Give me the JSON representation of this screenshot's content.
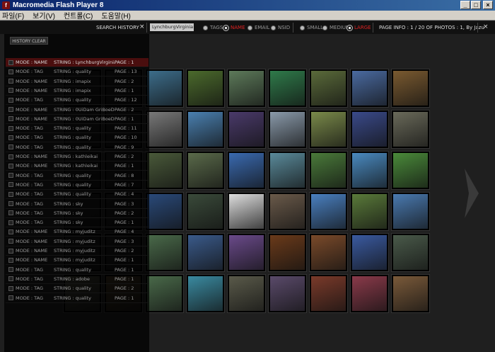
{
  "window": {
    "title": "Macromedia Flash Player 8",
    "icon": "flash-icon",
    "minimize": "_",
    "maximize": "□",
    "close": "×"
  },
  "menu": [
    "파일(F)",
    "보기(V)",
    "컨트롤(C)",
    "도움말(H)"
  ],
  "toolbar": {
    "search_history_label": "SEARCH HISTORY",
    "close_glyph": "×",
    "search_value": "LynchburgVirginia",
    "search_type_options": [
      {
        "label": "TAGS",
        "selected": false
      },
      {
        "label": "NAME",
        "selected": true
      },
      {
        "label": "EMAIL",
        "selected": false
      },
      {
        "label": "NSID",
        "selected": false
      }
    ],
    "size_options": [
      {
        "label": "SMALL",
        "selected": false
      },
      {
        "label": "MEDIUM",
        "selected": false
      },
      {
        "label": "LARGE",
        "selected": true
      }
    ],
    "page_info": "PAGE INFO : 1 / 20 OF PHOTOS : 1, By Jazu",
    "accent_color": "#d22222"
  },
  "history": {
    "clear_label": "HISTORY CLEAR",
    "rows": [
      {
        "mode": "MODE : NAME",
        "string": "STRING : LynchburgVirginia",
        "page": "PAGE : 1",
        "active": true
      },
      {
        "mode": "MODE : TAG",
        "string": "STRING : quality",
        "page": "PAGE : 13"
      },
      {
        "mode": "MODE : NAME",
        "string": "STRING : imapix",
        "page": "PAGE : 2"
      },
      {
        "mode": "MODE : NAME",
        "string": "STRING : imapix",
        "page": "PAGE : 1"
      },
      {
        "mode": "MODE : TAG",
        "string": "STRING : quality",
        "page": "PAGE : 12"
      },
      {
        "mode": "MODE : NAME",
        "string": "STRING : 0UiDam GriBoeDou",
        "page": "PAGE : 2"
      },
      {
        "mode": "MODE : NAME",
        "string": "STRING : 0UiDam GriBoeDou",
        "page": "PAGE : 1"
      },
      {
        "mode": "MODE : TAG",
        "string": "STRING : quality",
        "page": "PAGE : 11"
      },
      {
        "mode": "MODE : TAG",
        "string": "STRING : quality",
        "page": "PAGE : 10"
      },
      {
        "mode": "MODE : TAG",
        "string": "STRING : quality",
        "page": "PAGE : 9"
      },
      {
        "mode": "MODE : NAME",
        "string": "STRING : kathleikai",
        "page": "PAGE : 2"
      },
      {
        "mode": "MODE : NAME",
        "string": "STRING : kathleikai",
        "page": "PAGE : 1"
      },
      {
        "mode": "MODE : TAG",
        "string": "STRING : quality",
        "page": "PAGE : 8"
      },
      {
        "mode": "MODE : TAG",
        "string": "STRING : quality",
        "page": "PAGE : 7"
      },
      {
        "mode": "MODE : TAG",
        "string": "STRING : quality",
        "page": "PAGE : 4"
      },
      {
        "mode": "MODE : TAG",
        "string": "STRING : sky",
        "page": "PAGE : 3"
      },
      {
        "mode": "MODE : TAG",
        "string": "STRING : sky",
        "page": "PAGE : 2"
      },
      {
        "mode": "MODE : TAG",
        "string": "STRING : sky",
        "page": "PAGE : 1"
      },
      {
        "mode": "MODE : NAME",
        "string": "STRING : myjuditz",
        "page": "PAGE : 4"
      },
      {
        "mode": "MODE : NAME",
        "string": "STRING : myjuditz",
        "page": "PAGE : 3"
      },
      {
        "mode": "MODE : NAME",
        "string": "STRING : myjuditz",
        "page": "PAGE : 2"
      },
      {
        "mode": "MODE : NAME",
        "string": "STRING : myjuditz",
        "page": "PAGE : 1"
      },
      {
        "mode": "MODE : TAG",
        "string": "STRING : quality",
        "page": "PAGE : 1"
      },
      {
        "mode": "MODE : TAG",
        "string": "STRING : adobe",
        "page": "PAGE : 1"
      },
      {
        "mode": "MODE : TAG",
        "string": "STRING : quality",
        "page": "PAGE : 2"
      },
      {
        "mode": "MODE : TAG",
        "string": "STRING : quality",
        "page": "PAGE : 1"
      }
    ]
  },
  "photos": {
    "columns": 9,
    "rows": 6,
    "tiles": [
      [
        "#1a1a1a",
        "#1a1a1a",
        "#3d6e8c",
        "#4b6a2c",
        "#5d7a5a",
        "#2f7a4a",
        "#5a6a3a",
        "#4a6aa0",
        "#7a5a30"
      ],
      [
        "#1a1a1a",
        "#1a1a1a",
        "#7a7a7a",
        "#4a80b0",
        "#4a3a6a",
        "#8a9aaa",
        "#7a8a4a",
        "#3a4a8a",
        "#6a6a5a"
      ],
      [
        "#1a1a1a",
        "#1a1a1a",
        "#4a5a3a",
        "#5a6a4a",
        "#3a6ab0",
        "#5a8a9a",
        "#4a7a3a",
        "#4a8ac0",
        "#4a8a3a"
      ],
      [
        "#1a1a1a",
        "#1a1a1a",
        "#2a4a7a",
        "#3a4a3a",
        "#ddd",
        "#6a5a4a",
        "#4a80c0",
        "#5a7a3a",
        "#4a7ab0"
      ],
      [
        "#1a1a1a",
        "#1a1a1a",
        "#4a6a4a",
        "#3a5a8a",
        "#6a4a8a",
        "#6a3a1a",
        "#7a4a2a",
        "#3a5aa0",
        "#4a5a4a"
      ],
      [
        "#3a3a30",
        "#3a3020",
        "#4a6a4a",
        "#3a8aa0",
        "#5a5a4a",
        "#5a4a6a",
        "#7a3a2a",
        "#8a3a4a",
        "#7a5a3a"
      ]
    ]
  }
}
